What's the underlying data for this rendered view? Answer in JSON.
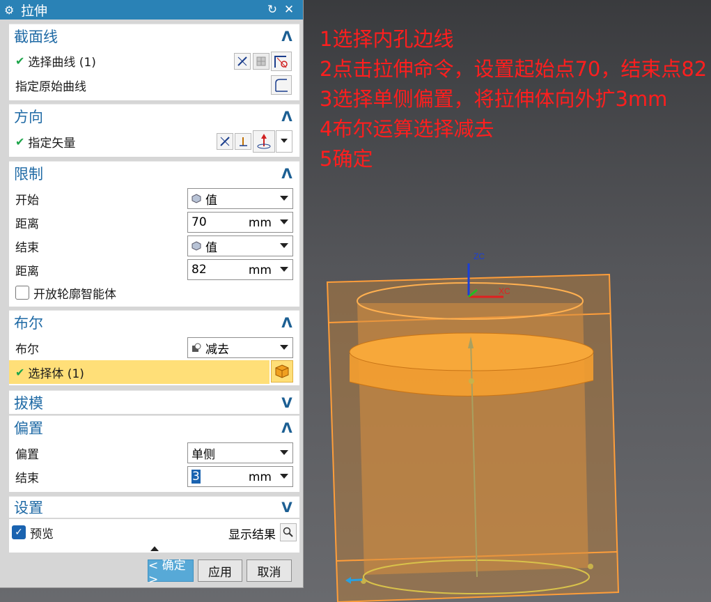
{
  "dialog": {
    "title": "拉伸",
    "reset_icon": "reset-icon",
    "close_icon": "close-icon",
    "sections": {
      "section_curve": {
        "title": "截面线",
        "select_curve": "选择曲线 (1)",
        "specify_original": "指定原始曲线"
      },
      "direction": {
        "title": "方向",
        "specify_vector": "指定矢量"
      },
      "limits": {
        "title": "限制",
        "start_label": "开始",
        "start_value": "值",
        "start_distance_label": "距离",
        "start_distance": "70",
        "end_label": "结束",
        "end_value": "值",
        "end_distance_label": "距离",
        "end_distance": "82",
        "unit": "mm",
        "open_profile": "开放轮廓智能体"
      },
      "boolean": {
        "title": "布尔",
        "boolean_label": "布尔",
        "boolean_value": "减去",
        "select_body": "选择体 (1)"
      },
      "draft": {
        "title": "拔模"
      },
      "offset": {
        "title": "偏置",
        "offset_label": "偏置",
        "offset_value": "单侧",
        "end_label": "结束",
        "end_value": "3",
        "unit": "mm"
      },
      "settings": {
        "title": "设置"
      }
    },
    "preview_label": "预览",
    "show_result_label": "显示结果",
    "ok_label": "< 确定 >",
    "apply_label": "应用",
    "cancel_label": "取消"
  },
  "instructions": [
    "1选择内孔边线",
    "2点击拉伸命令，设置起始点70，结束点82",
    "3选择单侧偏置，将拉伸体向外扩3mm",
    "4布尔运算选择减去",
    "5确定"
  ],
  "scene": {
    "axis_z_label": "ZC",
    "axis_x_label": "XC"
  },
  "colors": {
    "title_bar": "#2a82b6",
    "section_title": "#1f6aa5",
    "instruction_text": "#ff1e1e",
    "selection_highlight": "#ffdf78",
    "model_orange": "#f5a030"
  }
}
